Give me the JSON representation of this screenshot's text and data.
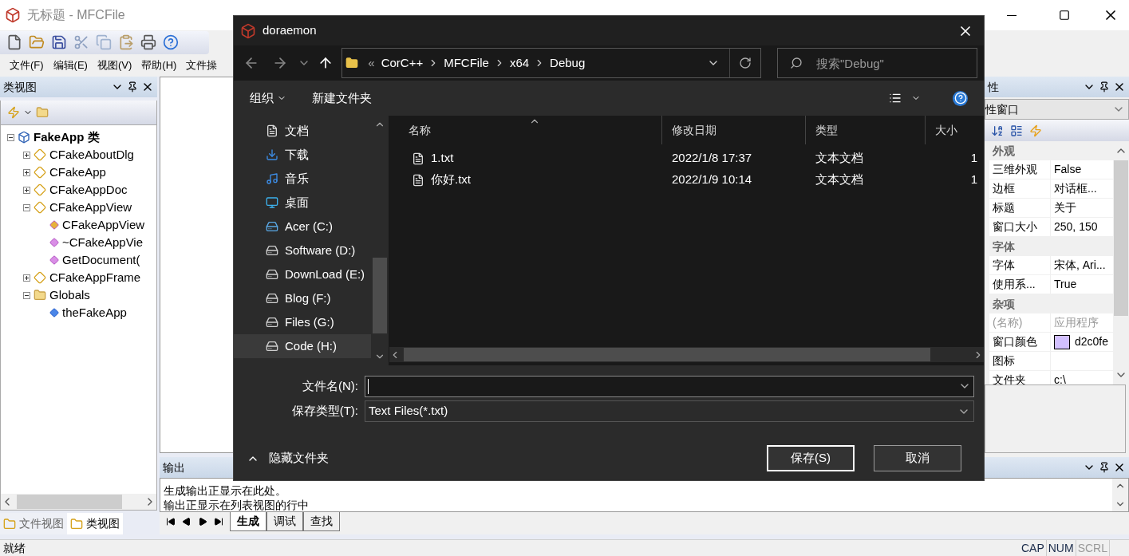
{
  "main_window": {
    "title": "无标题 - MFCFile"
  },
  "menu": [
    "文件(F)",
    "编辑(E)",
    "视图(V)",
    "帮助(H)",
    "文件操"
  ],
  "class_view": {
    "title": "类视图",
    "tree": [
      {
        "label": "FakeApp 类",
        "kind": "project",
        "expanded": true,
        "children": [
          {
            "label": "CFakeAboutDlg",
            "kind": "class",
            "expanded": false
          },
          {
            "label": "CFakeApp",
            "kind": "class",
            "expanded": false
          },
          {
            "label": "CFakeAppDoc",
            "kind": "class",
            "expanded": false
          },
          {
            "label": "CFakeAppView",
            "kind": "class",
            "expanded": true,
            "children": [
              {
                "label": "CFakeAppView",
                "kind": "protected-method"
              },
              {
                "label": "~CFakeAppVie",
                "kind": "method"
              },
              {
                "label": "GetDocument(",
                "kind": "method"
              }
            ]
          },
          {
            "label": "CFakeAppFrame",
            "kind": "class",
            "expanded": false
          },
          {
            "label": "Globals",
            "kind": "folder",
            "expanded": true,
            "children": [
              {
                "label": "theFakeApp",
                "kind": "global"
              }
            ]
          }
        ]
      }
    ],
    "tabs": [
      {
        "label": "文件视图",
        "selected": false
      },
      {
        "label": "类视图",
        "selected": true
      }
    ]
  },
  "properties": {
    "title": "性",
    "combo": "性窗口",
    "categories": [
      {
        "name": "外观",
        "items": [
          {
            "name": "三维外观",
            "value": "False",
            "disabled": false
          },
          {
            "name": "边框",
            "value": "对话框...",
            "disabled": false
          },
          {
            "name": "标题",
            "value": "关于",
            "disabled": false
          },
          {
            "name": "窗口大小",
            "value": "250, 150",
            "disabled": false
          }
        ]
      },
      {
        "name": "字体",
        "items": [
          {
            "name": "字体",
            "value": "宋体, Ari...",
            "disabled": false
          },
          {
            "name": "使用系...",
            "value": "True",
            "disabled": false
          }
        ]
      },
      {
        "name": "杂项",
        "items": [
          {
            "name": "(名称)",
            "value": "应用程序",
            "disabled": true
          },
          {
            "name": "窗口颜色",
            "value": "d2c0fe",
            "disabled": false,
            "color": "#d2c0fe"
          },
          {
            "name": "图标",
            "disabled": false
          },
          {
            "name": "文件夹",
            "value": "c:\\",
            "disabled": false
          }
        ]
      }
    ]
  },
  "output": {
    "title": "输出",
    "lines": [
      "生成输出正显示在此处。",
      "输出正显示在列表视图的行中"
    ],
    "tabs": [
      {
        "label": "生成",
        "selected": true
      },
      {
        "label": "调试",
        "selected": false
      },
      {
        "label": "查找",
        "selected": false
      }
    ]
  },
  "status_bar": {
    "text": "就绪",
    "indicators": [
      {
        "label": "CAP",
        "on": true
      },
      {
        "label": "NUM",
        "on": true
      },
      {
        "label": "SCRL",
        "on": false
      }
    ]
  },
  "dialog": {
    "title": "doraemon",
    "breadcrumb": [
      "«",
      "CorC++",
      "MFCFile",
      "x64",
      "Debug"
    ],
    "search": {
      "placeholder": "搜索\"Debug\""
    },
    "commands": [
      "组织",
      "新建文件夹"
    ],
    "nav": [
      {
        "label": "文档",
        "kind": "documents",
        "selected": false
      },
      {
        "label": "下载",
        "kind": "download",
        "selected": false
      },
      {
        "label": "音乐",
        "kind": "music",
        "selected": false
      },
      {
        "label": "桌面",
        "kind": "desktop",
        "selected": false
      },
      {
        "label": "Acer (C:)",
        "kind": "system-drive",
        "selected": false
      },
      {
        "label": "Software (D:)",
        "kind": "drive",
        "selected": false
      },
      {
        "label": "DownLoad (E:)",
        "kind": "drive",
        "selected": false
      },
      {
        "label": "Blog (F:)",
        "kind": "drive",
        "selected": false
      },
      {
        "label": "Files (G:)",
        "kind": "drive",
        "selected": false
      },
      {
        "label": "Code (H:)",
        "kind": "drive",
        "selected": true
      }
    ],
    "columns": [
      "名称",
      "修改日期",
      "类型",
      "大小"
    ],
    "rows": [
      {
        "name": "1.txt",
        "date": "2022/1/8 17:37",
        "type": "文本文档",
        "size": "1"
      },
      {
        "name": "你好.txt",
        "date": "2022/1/9 10:14",
        "type": "文本文档",
        "size": "1"
      }
    ],
    "file_name": {
      "label": "文件名(N):"
    },
    "file_type": {
      "label": "保存类型(T):",
      "value": "Text Files(*.txt)"
    },
    "hide_folders": "隐藏文件夹",
    "buttons": [
      {
        "label": "保存(S)",
        "default": true
      },
      {
        "label": "取消",
        "default": false
      }
    ]
  }
}
